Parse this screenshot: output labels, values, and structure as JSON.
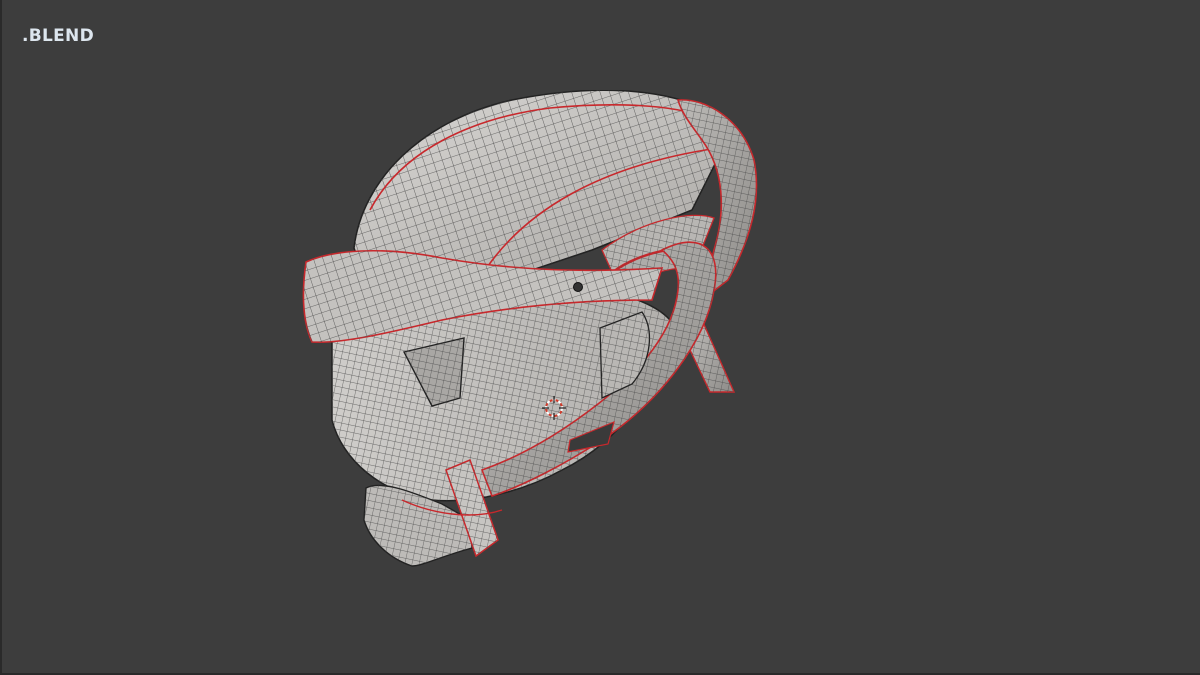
{
  "viewport": {
    "file_label": ".BLEND",
    "background_color": "#3d3d3d"
  },
  "model": {
    "object": "sci-fi-helmet",
    "display": "wireframe-overlay",
    "surface_color": "#c9c7c3",
    "wire_color": "#4a4a4a",
    "seam_color": "#c8282c"
  },
  "cursor": {
    "icon": "3d-cursor-icon"
  }
}
